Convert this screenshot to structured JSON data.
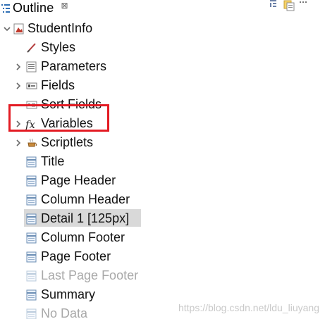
{
  "tab": {
    "title": "Outline",
    "close_symbol": "⊠"
  },
  "tree": {
    "root": "StudentInfo",
    "items": [
      {
        "label": "Styles",
        "icon": "style-icon",
        "expandable": false,
        "disabled": false
      },
      {
        "label": "Parameters",
        "icon": "parameters-icon",
        "expandable": true,
        "disabled": false
      },
      {
        "label": "Fields",
        "icon": "fields-icon",
        "expandable": true,
        "disabled": false
      },
      {
        "label": "Sort Fields",
        "icon": "sort-fields-icon",
        "expandable": false,
        "disabled": false
      },
      {
        "label": "Variables",
        "icon": "fx-icon",
        "expandable": true,
        "disabled": false
      },
      {
        "label": "Scriptlets",
        "icon": "scriptlets-icon",
        "expandable": true,
        "disabled": false
      },
      {
        "label": "Title",
        "icon": "band-icon",
        "expandable": false,
        "disabled": false
      },
      {
        "label": "Page Header",
        "icon": "band-icon",
        "expandable": false,
        "disabled": false
      },
      {
        "label": "Column Header",
        "icon": "band-icon",
        "expandable": false,
        "disabled": false
      },
      {
        "label": "Detail 1 [125px]",
        "icon": "band-icon",
        "expandable": false,
        "disabled": false
      },
      {
        "label": "Column Footer",
        "icon": "band-icon",
        "expandable": false,
        "disabled": false
      },
      {
        "label": "Page Footer",
        "icon": "band-icon",
        "expandable": false,
        "disabled": false
      },
      {
        "label": "Last Page Footer",
        "icon": "band-icon",
        "expandable": false,
        "disabled": true
      },
      {
        "label": "Summary",
        "icon": "band-icon",
        "expandable": false,
        "disabled": false
      },
      {
        "label": "No Data",
        "icon": "band-icon",
        "expandable": false,
        "disabled": true
      }
    ]
  },
  "watermark": "https://blog.csdn.net/ldu_liuyang",
  "colors": {
    "highlight_box": "#e31b23",
    "selected": "#d9d9d9",
    "disabled_text": "#a8a8a8"
  }
}
